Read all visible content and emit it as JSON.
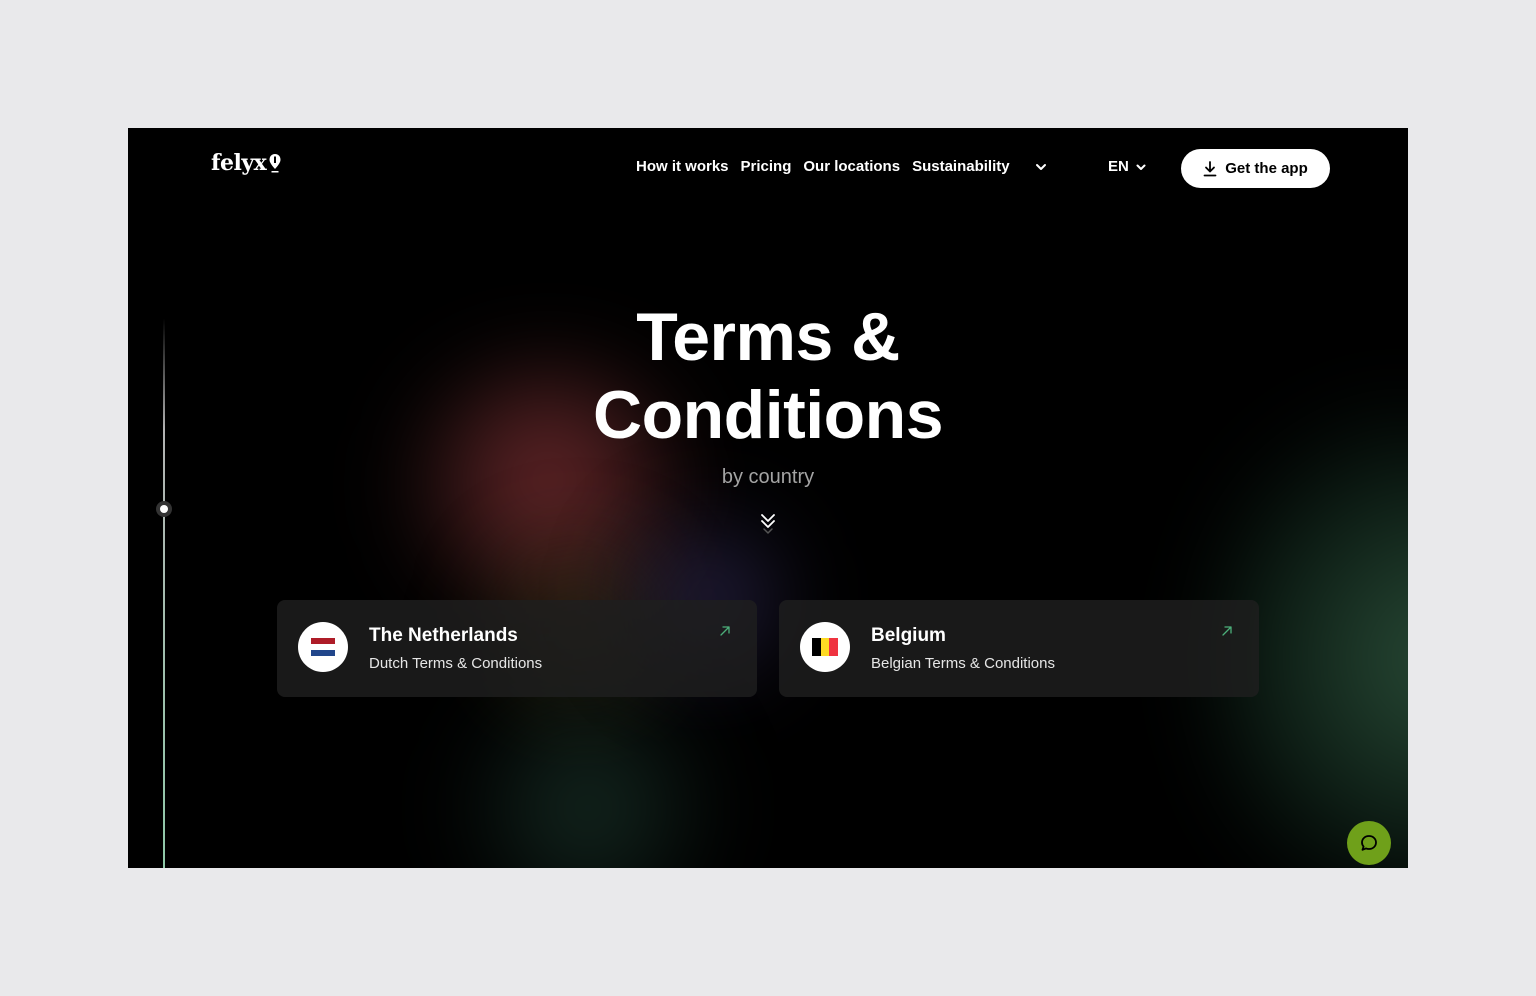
{
  "header": {
    "logo_text": "felyx",
    "nav": [
      {
        "label": "How it works"
      },
      {
        "label": "Pricing"
      },
      {
        "label": "Our locations"
      },
      {
        "label": "Sustainability"
      }
    ],
    "more_icon": "chevron-down-icon",
    "language": "EN",
    "cta_label": "Get the app",
    "cta_icon": "download-icon"
  },
  "hero": {
    "title_line1": "Terms &",
    "title_line2": "Conditions",
    "subtitle": "by country",
    "scroll_icon": "double-chevron-down-icon"
  },
  "countries": [
    {
      "name": "The Netherlands",
      "description": "Dutch Terms & Conditions",
      "flag_colors": [
        "#ae1c28",
        "#ffffff",
        "#21468b"
      ]
    },
    {
      "name": "Belgium",
      "description": "Belgian Terms & Conditions",
      "flag_colors": [
        "#000000",
        "#fdda24",
        "#ef3340"
      ]
    }
  ],
  "colors": {
    "accent_green": "#6fa01a",
    "arrow_green": "#4caf7a",
    "background": "#000000"
  },
  "chat": {
    "icon": "chat-bubble-icon"
  }
}
